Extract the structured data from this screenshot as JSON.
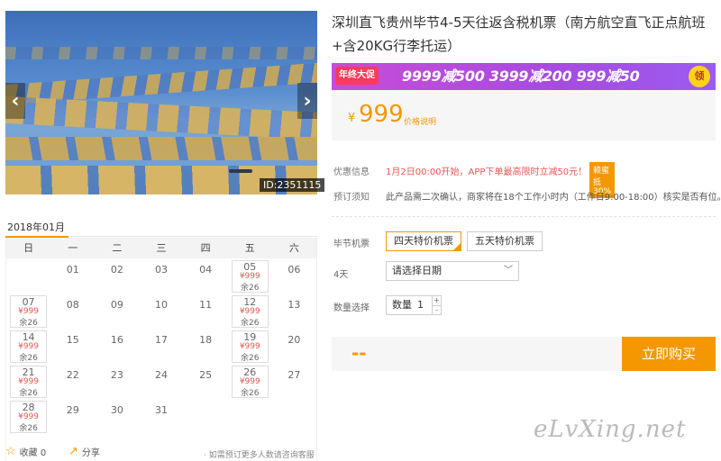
{
  "hero": {
    "image_id": "ID:2351115",
    "prev_label": "‹",
    "next_label": "›"
  },
  "title": "深圳直飞贵州毕节4-5天往返含税机票（南方航空直飞正点航班+含20KG行李托运）",
  "promo": {
    "tag": "年终大促",
    "text": "9999减500  3999减200  999减50",
    "claim": "领"
  },
  "price": {
    "currency": "¥",
    "amount": "999",
    "note": "价格说明"
  },
  "info": {
    "offer_label": "优惠信息",
    "offer_text": "1月2日00:00开始，APP下单最高限时立减50元！",
    "coupon": "赖蜜抵30%",
    "notice_label": "预订须知",
    "notice_text": "此产品需二次确认，商家将在18个工作小时内（工作日9:00-18:00）核实是否有位。"
  },
  "options": {
    "ticket_label": "毕节机票",
    "ticket_1": "四天特价机票",
    "ticket_2": "五天特价机票",
    "days_label": "4天",
    "date_placeholder": "请选择日期",
    "qty_label": "数量选择",
    "qty_prefix": "数量",
    "qty_value": "1",
    "plus": "+",
    "minus": "-"
  },
  "buy": {
    "total": "--",
    "button": "立即购买"
  },
  "calendar": {
    "month": "2018年01月",
    "weekdays": [
      "日",
      "一",
      "二",
      "三",
      "四",
      "五",
      "六"
    ],
    "weeks": [
      [
        {
          "d": ""
        },
        {
          "d": "01"
        },
        {
          "d": "02"
        },
        {
          "d": "03"
        },
        {
          "d": "04"
        },
        {
          "d": "05",
          "p": "¥999",
          "r": "余26"
        },
        {
          "d": "06"
        }
      ],
      [
        {
          "d": "07",
          "p": "¥999",
          "r": "余26"
        },
        {
          "d": "08"
        },
        {
          "d": "09"
        },
        {
          "d": "10"
        },
        {
          "d": "11"
        },
        {
          "d": "12",
          "p": "¥999",
          "r": "余26"
        },
        {
          "d": "13"
        }
      ],
      [
        {
          "d": "14",
          "p": "¥999",
          "r": "余26"
        },
        {
          "d": "15"
        },
        {
          "d": "16"
        },
        {
          "d": "17"
        },
        {
          "d": "18"
        },
        {
          "d": "19",
          "p": "¥999",
          "r": "余26"
        },
        {
          "d": "20"
        }
      ],
      [
        {
          "d": "21",
          "p": "¥999",
          "r": "余26"
        },
        {
          "d": "22"
        },
        {
          "d": "23"
        },
        {
          "d": "24"
        },
        {
          "d": "25"
        },
        {
          "d": "26",
          "p": "¥999",
          "r": "余26"
        },
        {
          "d": "27"
        }
      ],
      [
        {
          "d": "28",
          "p": "¥999",
          "r": "余26"
        },
        {
          "d": "29"
        },
        {
          "d": "30"
        },
        {
          "d": "31"
        },
        {
          "d": ""
        },
        {
          "d": ""
        },
        {
          "d": ""
        }
      ]
    ]
  },
  "footer": {
    "fav_label": "收藏 0",
    "share_label": "分享",
    "tip": "· 如需预订更多人数请咨询客服"
  },
  "watermark": "eLvXing.net",
  "colors": {
    "accent": "#f39800",
    "price_red": "#e55",
    "promo_purple": "#a64be0"
  }
}
